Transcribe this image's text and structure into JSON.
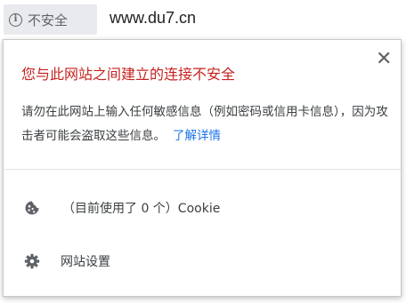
{
  "address_bar": {
    "security_label": "不安全",
    "info_icon": "info-icon",
    "url": "www.du7.cn"
  },
  "popup": {
    "title": "您与此网站之间建立的连接不安全",
    "close_icon": "close-icon",
    "description": "请勿在此网站上输入任何敏感信息（例如密码或信用卡信息），因为攻击者可能会盗取这些信息。",
    "learn_more": "了解详情",
    "cookie_row": {
      "icon": "cookie-icon",
      "label": "（目前使用了 0 个）Cookie"
    },
    "settings_row": {
      "icon": "gear-icon",
      "label": "网站设置"
    }
  },
  "colors": {
    "title_warning": "#c5221f",
    "link": "#1a73e8",
    "chip_background": "#e8eaed"
  }
}
